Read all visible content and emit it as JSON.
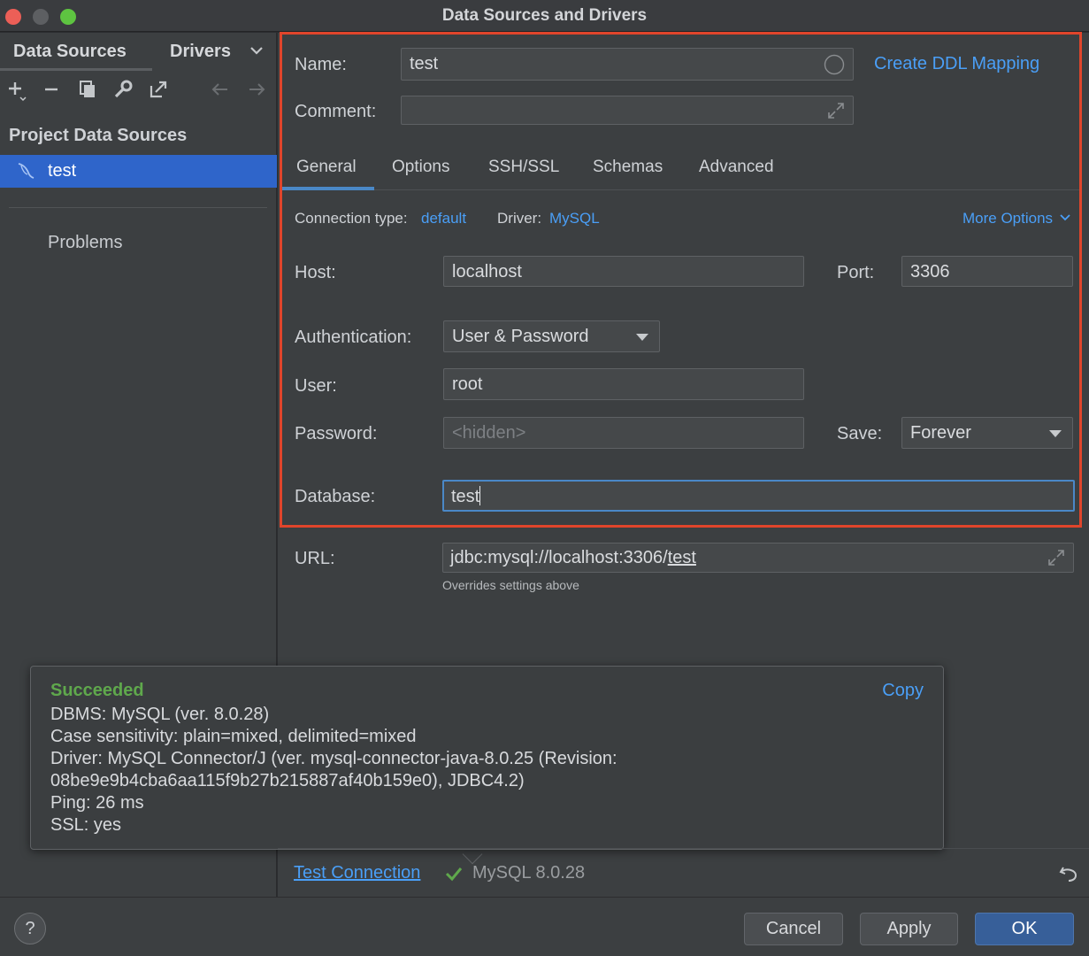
{
  "window": {
    "title": "Data Sources and Drivers"
  },
  "sidebar": {
    "tabs": [
      {
        "label": "Data Sources"
      },
      {
        "label": "Drivers"
      }
    ],
    "section_title": "Project Data Sources",
    "selected_item": "test",
    "problems_label": "Problems"
  },
  "form": {
    "name_label": "Name:",
    "name_value": "test",
    "create_ddl_link": "Create DDL Mapping",
    "comment_label": "Comment:",
    "comment_value": "",
    "tabs": [
      {
        "label": "General"
      },
      {
        "label": "Options"
      },
      {
        "label": "SSH/SSL"
      },
      {
        "label": "Schemas"
      },
      {
        "label": "Advanced"
      }
    ],
    "connection_type_label": "Connection type:",
    "connection_type_value": "default",
    "driver_label": "Driver:",
    "driver_value": "MySQL",
    "more_options": "More Options",
    "host_label": "Host:",
    "host_value": "localhost",
    "port_label": "Port:",
    "port_value": "3306",
    "auth_label": "Authentication:",
    "auth_value": "User & Password",
    "user_label": "User:",
    "user_value": "root",
    "password_label": "Password:",
    "password_placeholder": "<hidden>",
    "save_label": "Save:",
    "save_value": "Forever",
    "database_label": "Database:",
    "database_value": "test",
    "url_label": "URL:",
    "url_prefix": "jdbc:mysql://localhost:3306/",
    "url_db": "test",
    "url_hint": "Overrides settings above"
  },
  "popup": {
    "title": "Succeeded",
    "copy_label": "Copy",
    "lines": [
      "DBMS: MySQL (ver. 8.0.28)",
      "Case sensitivity: plain=mixed, delimited=mixed",
      "Driver: MySQL Connector/J (ver. mysql-connector-java-8.0.25 (Revision:",
      "08be9e9b4cba6aa115f9b27b215887af40b159e0), JDBC4.2)",
      "Ping: 26 ms",
      "SSL: yes"
    ]
  },
  "status": {
    "test_connection": "Test Connection",
    "server_version": "MySQL 8.0.28"
  },
  "footer": {
    "help_label": "?",
    "cancel_label": "Cancel",
    "apply_label": "Apply",
    "ok_label": "OK"
  },
  "colors": {
    "accent": "#2f65ca",
    "link": "#4a9ff7",
    "success": "#5fa84c",
    "highlight_border": "#e0452b"
  }
}
